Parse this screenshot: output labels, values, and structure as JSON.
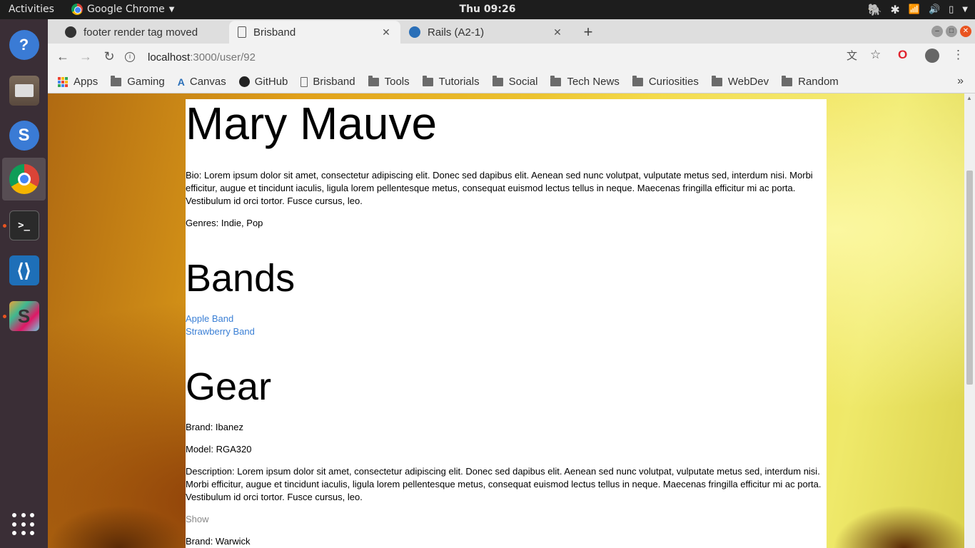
{
  "topbar": {
    "activities": "Activities",
    "app_name": "Google Chrome",
    "clock": "Thu 09:26"
  },
  "browser": {
    "tabs": [
      {
        "label": "footer render tag moved",
        "icon": "github-icon"
      },
      {
        "label": "Brisband",
        "icon": "page-icon"
      },
      {
        "label": "Rails (A2-1)",
        "icon": "canvas-icon"
      }
    ],
    "url": {
      "host": "localhost",
      "path": ":3000/user/92"
    },
    "bookmarks": [
      "Apps",
      "Gaming",
      "Canvas",
      "GitHub",
      "Brisband",
      "Tools",
      "Tutorials",
      "Social",
      "Tech News",
      "Curiosities",
      "WebDev",
      "Random"
    ]
  },
  "page": {
    "name": "Mary Mauve",
    "bio": "Bio: Lorem ipsum dolor sit amet, consectetur adipiscing elit. Donec sed dapibus elit. Aenean sed nunc volutpat, vulputate metus sed, interdum nisi. Morbi efficitur, augue et tincidunt iaculis, ligula lorem pellentesque metus, consequat euismod lectus tellus in neque. Maecenas fringilla efficitur mi ac porta. Vestibulum id orci tortor. Fusce cursus, leo.",
    "genres": "Genres: Indie, Pop",
    "bands_heading": "Bands",
    "bands": [
      "Apple Band",
      "Strawberry Band"
    ],
    "gear_heading": "Gear",
    "gear": [
      {
        "brand": "Brand: Ibanez",
        "model": "Model: RGA320",
        "description": "Description: Lorem ipsum dolor sit amet, consectetur adipiscing elit. Donec sed dapibus elit. Aenean sed nunc volutpat, vulputate metus sed, interdum nisi. Morbi efficitur, augue et tincidunt iaculis, ligula lorem pellentesque metus, consequat euismod lectus tellus in neque. Maecenas fringilla efficitur mi ac porta. Vestibulum id orci tortor. Fusce cursus, leo.",
        "show": "Show"
      },
      {
        "brand": "Brand: Warwick"
      }
    ]
  },
  "colors": {
    "link": "#3a7fd5",
    "ubuntu_accent": "#e95420"
  }
}
